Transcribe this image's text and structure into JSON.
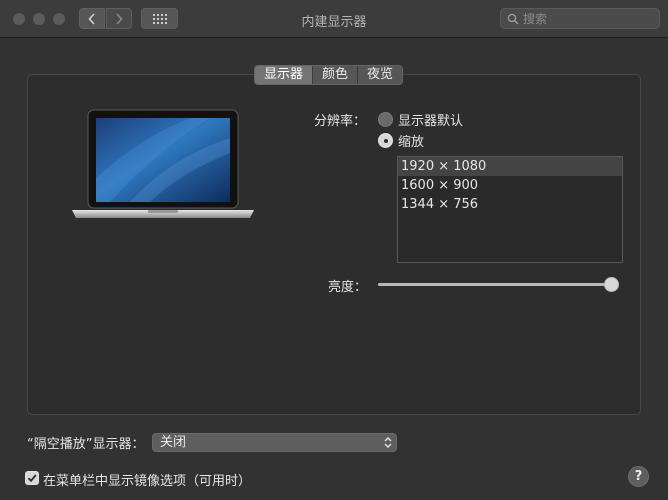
{
  "window": {
    "title": "内建显示器",
    "search_placeholder": "搜索"
  },
  "tabs": [
    {
      "label": "显示器",
      "active": true
    },
    {
      "label": "颜色",
      "active": false
    },
    {
      "label": "夜览",
      "active": false
    }
  ],
  "resolution": {
    "label": "分辨率：",
    "options": [
      {
        "label": "显示器默认",
        "selected": false
      },
      {
        "label": "缩放",
        "selected": true
      }
    ],
    "list": [
      {
        "label": "1920 × 1080",
        "selected": true
      },
      {
        "label": "1600 × 900",
        "selected": false
      },
      {
        "label": "1344 × 756",
        "selected": false
      }
    ]
  },
  "brightness": {
    "label": "亮度：",
    "value_fraction": 0.97
  },
  "airplay": {
    "label": "“隔空播放”显示器：",
    "selected": "关闭"
  },
  "mirror_option": {
    "label": "在菜单栏中显示镜像选项（可用时）",
    "checked": true
  },
  "help_label": "?",
  "colors": {
    "accent": "#d8d8d8",
    "background": "#323232",
    "screen_blue": "#2a6fb3"
  }
}
